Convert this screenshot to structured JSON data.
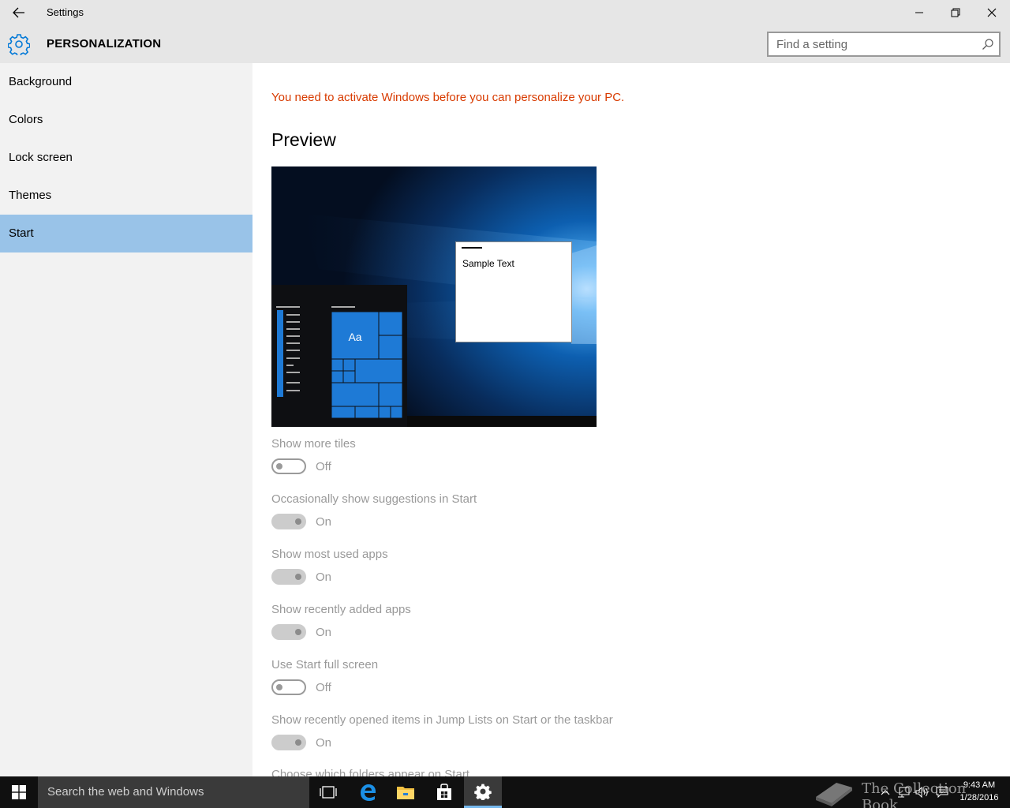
{
  "window": {
    "title": "Settings",
    "back_icon": "back-arrow-icon",
    "controls": [
      "minimize-icon",
      "restore-icon",
      "close-icon"
    ]
  },
  "header": {
    "icon": "gear-icon",
    "title": "PERSONALIZATION",
    "search_placeholder": "Find a setting",
    "search_icon": "search-icon"
  },
  "sidebar": {
    "items": [
      {
        "label": "Background",
        "active": false
      },
      {
        "label": "Colors",
        "active": false
      },
      {
        "label": "Lock screen",
        "active": false
      },
      {
        "label": "Themes",
        "active": false
      },
      {
        "label": "Start",
        "active": true
      }
    ]
  },
  "main": {
    "warning": "You need to activate Windows before you can personalize your PC.",
    "preview_title": "Preview",
    "preview": {
      "sample_text": "Sample Text",
      "tile_text": "Aa"
    },
    "settings": [
      {
        "label": "Show more tiles",
        "state": "Off"
      },
      {
        "label": "Occasionally show suggestions in Start",
        "state": "On"
      },
      {
        "label": "Show most used apps",
        "state": "On"
      },
      {
        "label": "Show recently added apps",
        "state": "On"
      },
      {
        "label": "Use Start full screen",
        "state": "Off"
      },
      {
        "label": "Show recently opened items in Jump Lists on Start or the taskbar",
        "state": "On"
      }
    ],
    "cut_off_setting": "Choose which folders appear on Start"
  },
  "taskbar": {
    "search_text": "Search the web and Windows",
    "apps": [
      "task-view-icon",
      "edge-icon",
      "file-explorer-icon",
      "store-icon",
      "settings-icon"
    ],
    "watermark": "The Collection Book",
    "time": "9:43 AM",
    "date": "1/28/2016"
  },
  "colors": {
    "accent": "#0078d7",
    "selected_nav": "#99c3e8",
    "warning": "#d83b01"
  }
}
